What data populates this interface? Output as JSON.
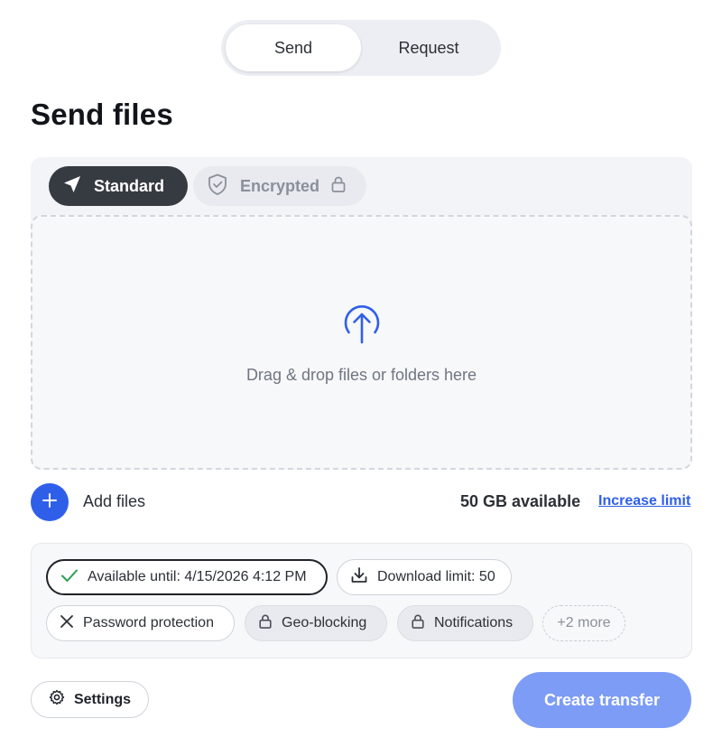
{
  "mode_toggle": {
    "tabs": [
      {
        "label": "Send",
        "active": true
      },
      {
        "label": "Request",
        "active": false
      }
    ]
  },
  "page": {
    "title": "Send files"
  },
  "transfer_types": {
    "standard": {
      "label": "Standard",
      "icon": "send-plane-icon"
    },
    "encrypted": {
      "label": "Encrypted",
      "icon": "shield-check-icon",
      "lock_icon": "lock-icon"
    }
  },
  "dropzone": {
    "text": "Drag & drop files or folders here",
    "icon": "upload-arrow-icon"
  },
  "add_files": {
    "label": "Add files",
    "icon": "plus-icon"
  },
  "storage": {
    "available": "50 GB available",
    "increase_label": "Increase limit"
  },
  "options": {
    "available_until": {
      "label": "Available until: 4/15/2026 4:12 PM",
      "icon": "check-icon"
    },
    "download_limit": {
      "label": "Download limit: 50",
      "icon": "download-icon"
    },
    "password_protection": {
      "label": "Password protection",
      "icon": "close-icon"
    },
    "geo_blocking": {
      "label": "Geo-blocking",
      "icon": "lock-icon"
    },
    "notifications": {
      "label": "Notifications",
      "icon": "lock-icon"
    },
    "more": {
      "label": "+2 more"
    }
  },
  "actions": {
    "settings_label": "Settings",
    "create_label": "Create transfer"
  },
  "colors": {
    "accent": "#2f5fe9",
    "create_button": "#7d9cf5",
    "dark_tab": "#363b42",
    "check_green": "#2e9e4f"
  }
}
